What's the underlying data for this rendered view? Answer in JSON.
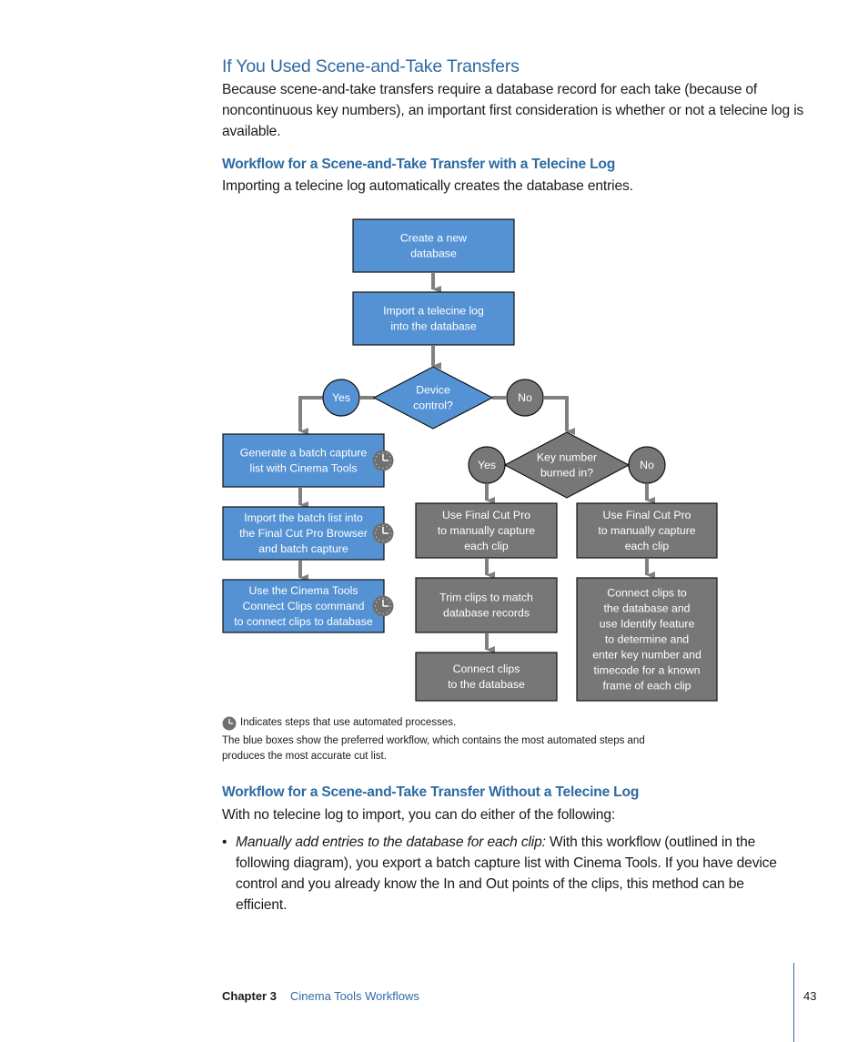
{
  "section": {
    "title": "If You Used Scene-and-Take Transfers",
    "intro": "Because scene-and-take transfers require a database record for each take (because of noncontinuous key numbers), an important first consideration is whether or not a telecine log is available."
  },
  "subsection1": {
    "title": "Workflow for a Scene-and-Take Transfer with a Telecine Log",
    "intro": "Importing a telecine log automatically creates the database entries."
  },
  "diagram": {
    "colors": {
      "blue": "#5592d4",
      "gray": "#777777",
      "connector": "#808080"
    },
    "nodes": {
      "create_db": [
        "Create a new",
        "database"
      ],
      "import_log": [
        "Import a telecine log",
        "into the database"
      ],
      "device_control": [
        "Device",
        "control?"
      ],
      "yes1": "Yes",
      "no1": "No",
      "generate_batch": [
        "Generate a batch capture",
        "list with Cinema Tools"
      ],
      "import_batch": [
        "Import the batch list into",
        "the Final Cut Pro Browser",
        "and batch capture"
      ],
      "connect_clips_cmd": [
        "Use the Cinema Tools",
        "Connect Clips command",
        "to connect clips to database"
      ],
      "key_number": [
        "Key number",
        "burned in?"
      ],
      "yes2": "Yes",
      "no2": "No",
      "fcp_capture_a": [
        "Use Final Cut Pro",
        "to manually capture",
        "each clip"
      ],
      "fcp_capture_b": [
        "Use Final Cut Pro",
        "to manually capture",
        "each clip"
      ],
      "trim_clips": [
        "Trim clips to match",
        "database records"
      ],
      "connect_db": [
        "Connect clips",
        "to the database"
      ],
      "connect_identify": [
        "Connect clips to",
        "the database and",
        "use Identify feature",
        "to determine and",
        "enter key number and",
        "timecode for a known",
        "frame of each clip"
      ]
    },
    "legend": "Indicates steps that use automated processes.",
    "caption_line1": "The blue boxes show the preferred workflow, which contains the most automated steps and",
    "caption_line2": "produces the most accurate cut list."
  },
  "subsection2": {
    "title": "Workflow for a Scene-and-Take Transfer Without a Telecine Log",
    "intro": "With no telecine log to import, you can do either of the following:",
    "bullets": [
      {
        "lead": "Manually add entries to the database for each clip:",
        "text": " With this workflow (outlined in the following diagram), you export a batch capture list with Cinema Tools. If you have device control and you already know the In and Out points of the clips, this method can be efficient."
      }
    ]
  },
  "footer": {
    "chapter": "Chapter 3",
    "title": "Cinema Tools Workflows",
    "page": "43"
  }
}
